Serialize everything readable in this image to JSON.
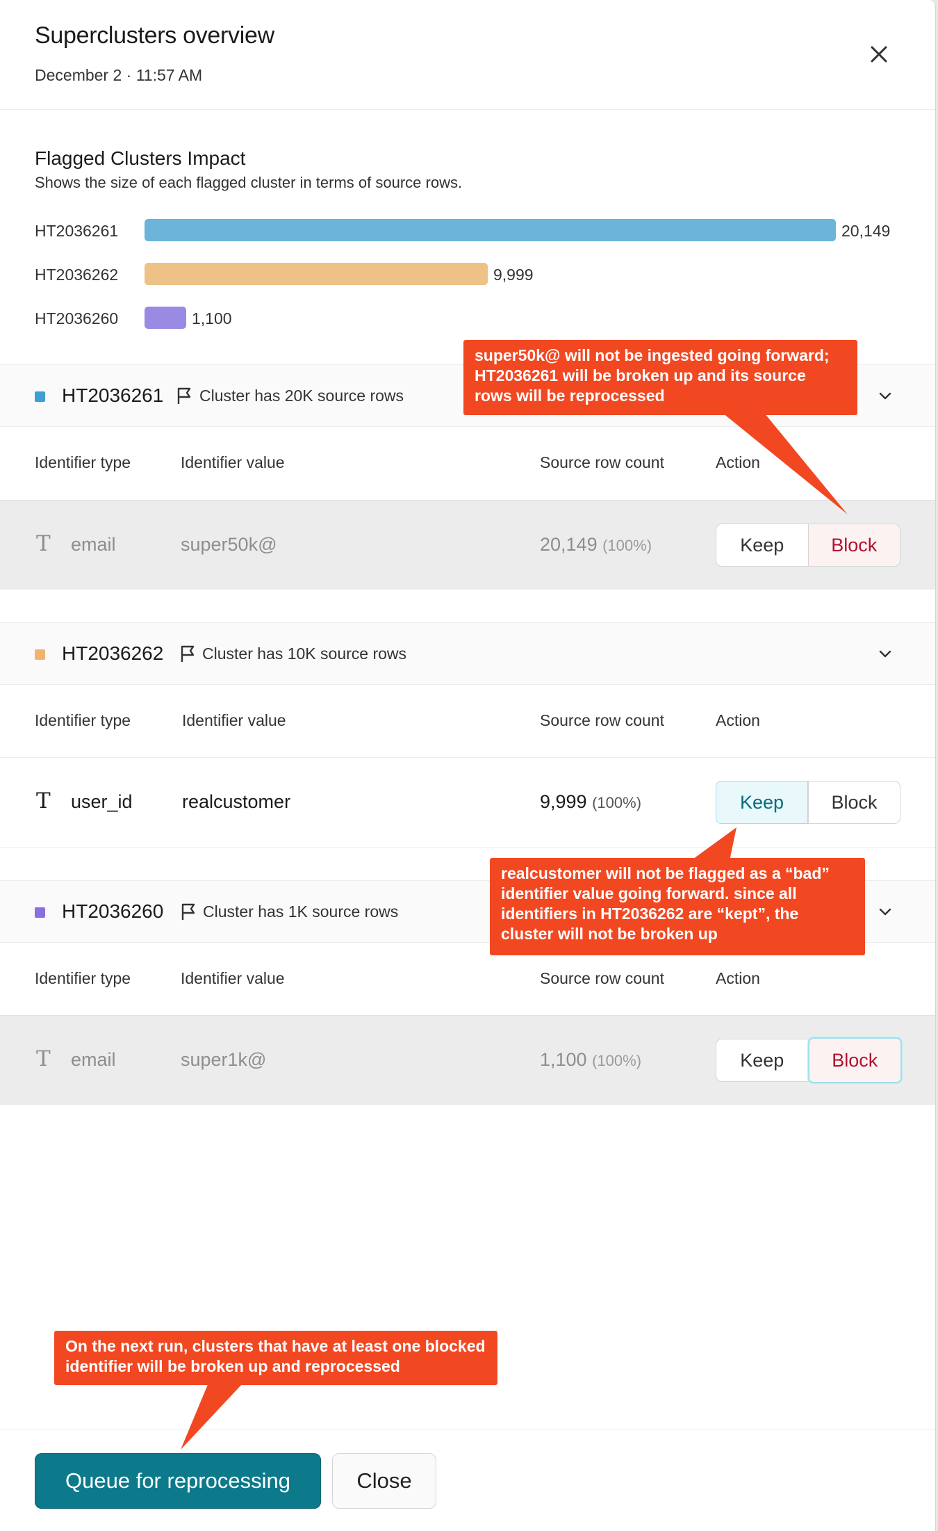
{
  "header": {
    "title": "Superclusters overview",
    "subtitle": "December 2 · 11:57 AM"
  },
  "impact": {
    "title": "Flagged Clusters Impact",
    "subtitle": "Shows the size of each flagged cluster in terms of source rows.",
    "bars": [
      {
        "label": "HT2036261",
        "value": 20149,
        "value_label": "20,149",
        "color": "#6cb4d9"
      },
      {
        "label": "HT2036262",
        "value": 9999,
        "value_label": "9,999",
        "color": "#eec286"
      },
      {
        "label": "HT2036260",
        "value": 1100,
        "value_label": "1,100",
        "color": "#9a8ae3"
      }
    ]
  },
  "columns": {
    "type": "Identifier type",
    "value": "Identifier value",
    "count": "Source row count",
    "action": "Action"
  },
  "clusters": [
    {
      "id": "HT2036261",
      "color": "#3e9fd2",
      "description": "Cluster has 20K source rows",
      "row": {
        "type": "email",
        "value": "super50k@",
        "count": "20,149",
        "pct": "(100%)",
        "keep": "Keep",
        "block": "Block",
        "selected": "Block"
      }
    },
    {
      "id": "HT2036262",
      "color": "#f0b470",
      "description": "Cluster has 10K source rows",
      "row": {
        "type": "user_id",
        "value": "realcustomer",
        "count": "9,999",
        "pct": "(100%)",
        "keep": "Keep",
        "block": "Block",
        "selected": "Keep"
      }
    },
    {
      "id": "HT2036260",
      "color": "#8a6fe0",
      "description": "Cluster has 1K source rows",
      "row": {
        "type": "email",
        "value": "super1k@",
        "count": "1,100",
        "pct": "(100%)",
        "keep": "Keep",
        "block": "Block",
        "selected": "Block"
      }
    }
  ],
  "icons": {
    "close": "close-icon",
    "flag": "flag-icon",
    "chevron": "chevron-down-icon",
    "text_type": "text-type-icon"
  },
  "footer": {
    "primary": "Queue for reprocessing",
    "secondary": "Close",
    "primary_color": "#0d7a8c"
  },
  "annotations": {
    "callout_1": "super50k@ will not be ingested going forward; HT2036261 will be broken up and its source rows will be reprocessed",
    "callout_2": "realcustomer will not be flagged as a “bad” identifier value going forward. since all identifiers in HT2036262 are “kept”, the cluster will not be broken up",
    "callout_3": "On the next run, clusters that have at least one blocked identifier will be broken up and reprocessed",
    "color": "#f24822"
  }
}
